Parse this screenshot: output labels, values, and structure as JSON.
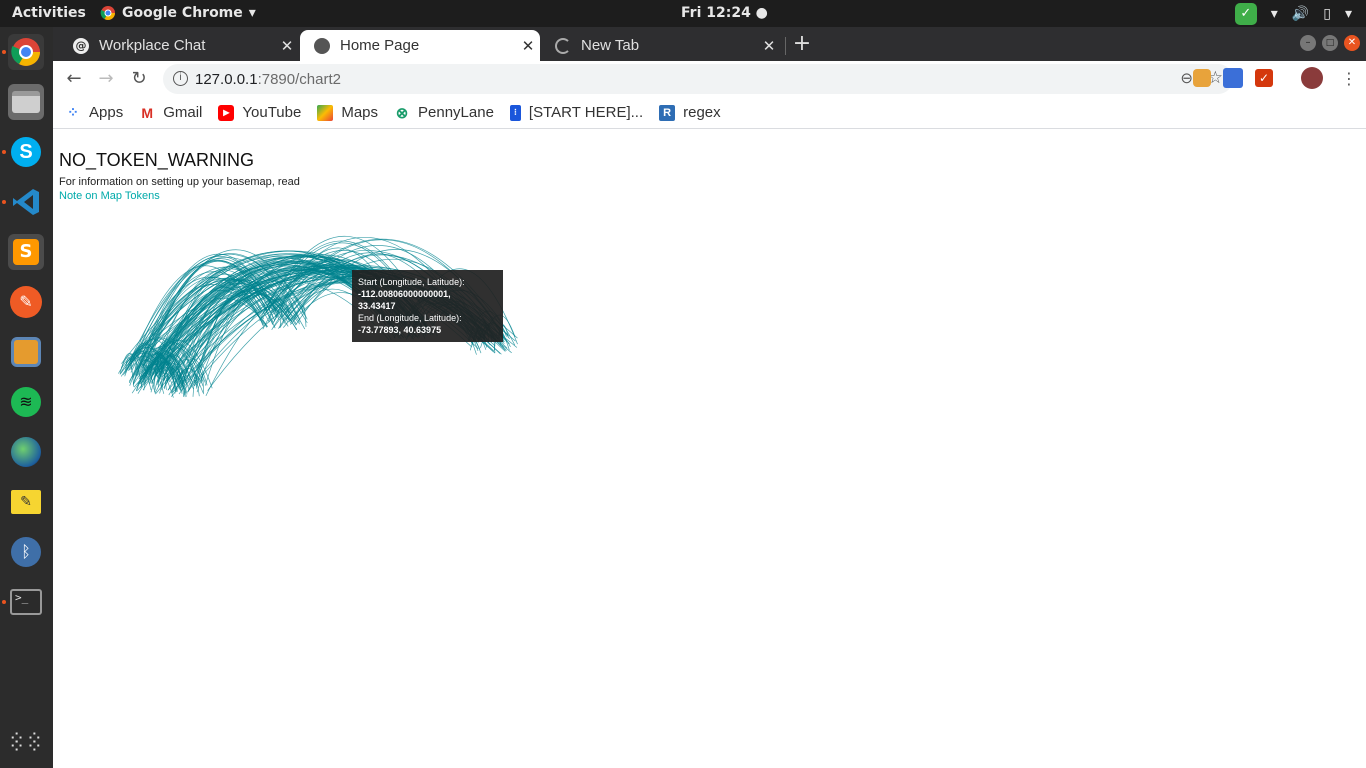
{
  "system": {
    "activities": "Activities",
    "app_name": "Google Chrome",
    "clock": "Fri 12:24"
  },
  "browser": {
    "tabs": [
      {
        "title": "Workplace Chat",
        "active": false
      },
      {
        "title": "Home Page",
        "active": true
      },
      {
        "title": "New Tab",
        "active": false
      }
    ],
    "url_host": "127.0.0.1",
    "url_rest": ":7890/chart2",
    "bookmarks": [
      {
        "label": "Apps",
        "icon": "apps-grid-icon"
      },
      {
        "label": "Gmail",
        "icon": "gmail-icon"
      },
      {
        "label": "YouTube",
        "icon": "youtube-icon"
      },
      {
        "label": "Maps",
        "icon": "maps-icon"
      },
      {
        "label": "PennyLane",
        "icon": "pennylane-icon"
      },
      {
        "label": "[START HERE]...",
        "icon": "doc-icon"
      },
      {
        "label": "regex",
        "icon": "r-icon"
      }
    ]
  },
  "page": {
    "warning_title": "NO_TOKEN_WARNING",
    "warning_text": "For information on setting up your basemap, read",
    "warning_link": "Note on Map Tokens",
    "arc_color": "#00838f",
    "tooltip": {
      "start_label": "Start (Longitude, Latitude):",
      "start_value_line1": "-112.00806000000001,",
      "start_value_line2": "33.43417",
      "end_label": "End (Longitude, Latitude):",
      "end_value": "-73.77893, 40.63975"
    }
  }
}
